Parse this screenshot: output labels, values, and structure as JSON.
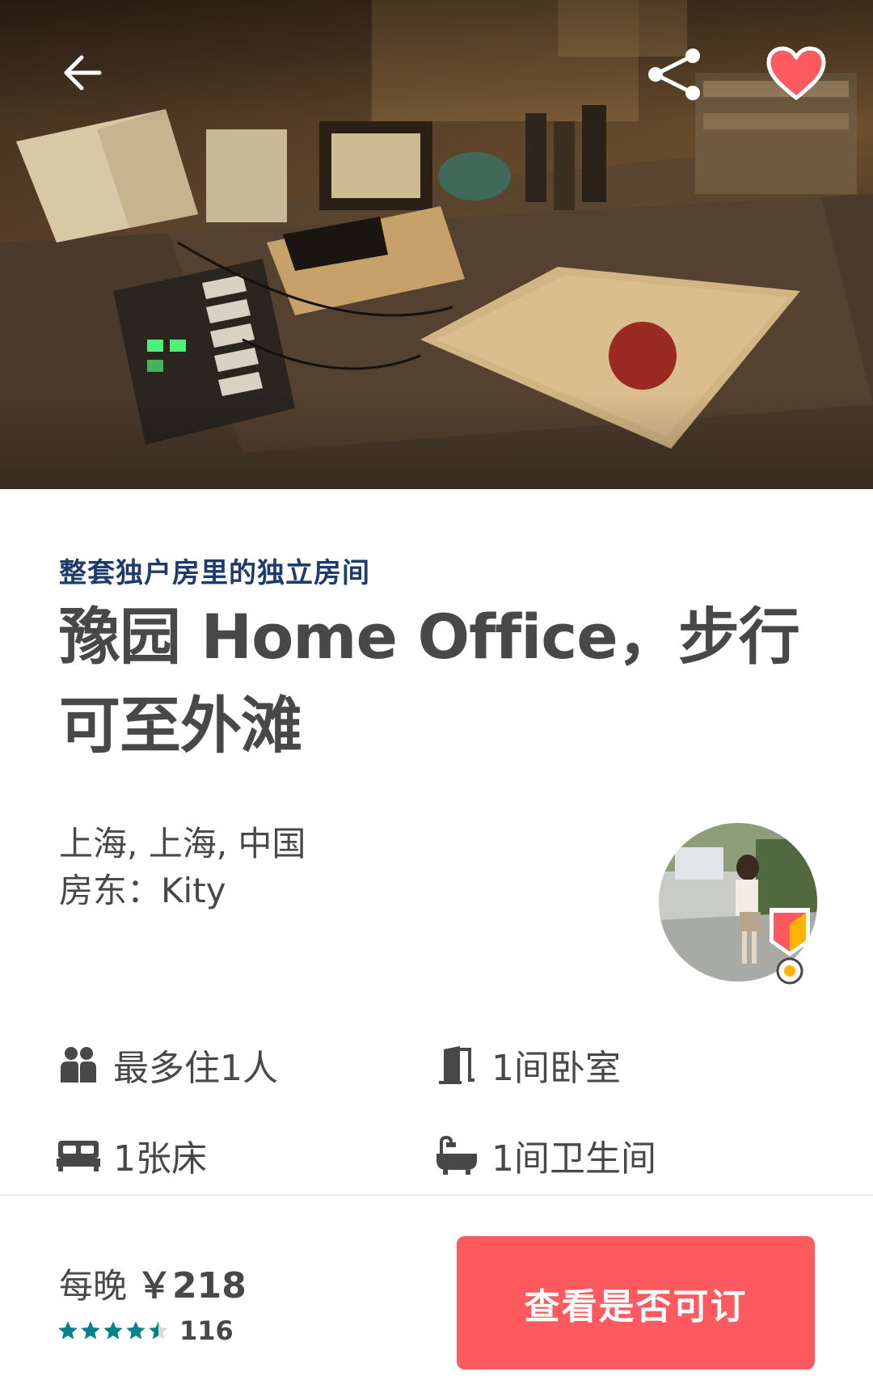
{
  "header": {
    "back_icon": "arrow-left-icon",
    "share_icon": "share-icon",
    "favorite_icon": "heart-icon",
    "favorite_color": "#ff5a5f"
  },
  "listing": {
    "room_type": "整套独户房里的独立房间",
    "title": "豫园 Home Office，步行可至外滩",
    "location": "上海, 上海, 中国",
    "host_label": "房东：",
    "host_name": "Kity"
  },
  "amenities": {
    "guests": "最多住1人",
    "bedrooms": "1间卧室",
    "beds": "1张床",
    "bathrooms": "1间卫生间"
  },
  "booking": {
    "per_night_label": "每晚",
    "price": "￥218",
    "rating_stars": 4.5,
    "review_count": "116",
    "cta_label": "查看是否可订",
    "cta_color": "#ff5a5f",
    "star_color": "#008489"
  }
}
